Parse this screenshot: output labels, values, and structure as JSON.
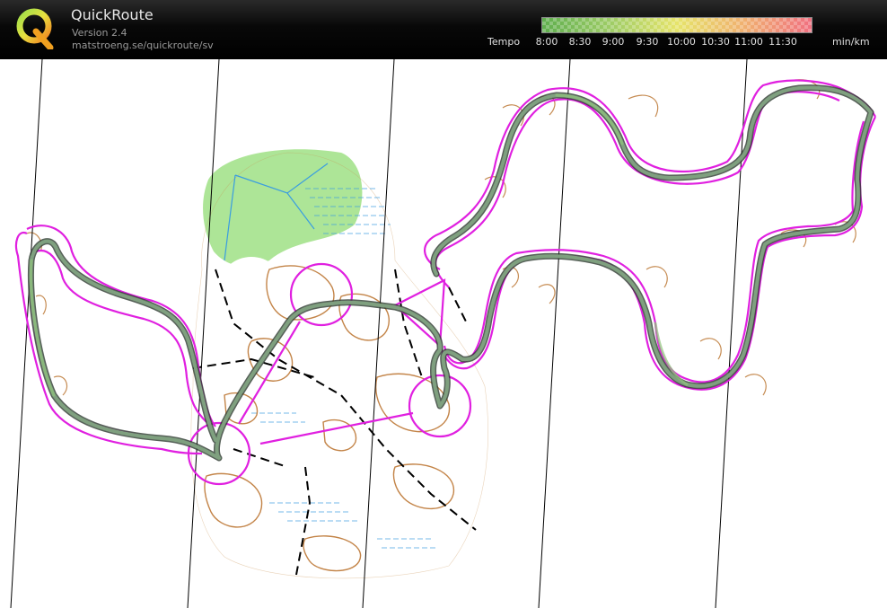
{
  "app": {
    "title": "QuickRoute",
    "version": "Version 2.4",
    "url": "matstroeng.se/quickroute/sv",
    "logo_letter": "Q"
  },
  "legend": {
    "label": "Tempo",
    "ticks": [
      "8:00",
      "8:30",
      "9:00",
      "9:30",
      "10:00",
      "10:30",
      "11:00",
      "11:30"
    ],
    "unit": "min/km",
    "colors": [
      "#5fae4e",
      "#9dcc66",
      "#e6e46a",
      "#f0b070",
      "#f07080"
    ]
  },
  "map": {
    "background": "#ffffff",
    "route_color": "#6a9a7a",
    "course_color": "#e020e0",
    "contour_color": "#b86f28",
    "vegetation_color": "#9fe085",
    "water_color": "#3a9de0",
    "meridian_color": "#000000"
  }
}
